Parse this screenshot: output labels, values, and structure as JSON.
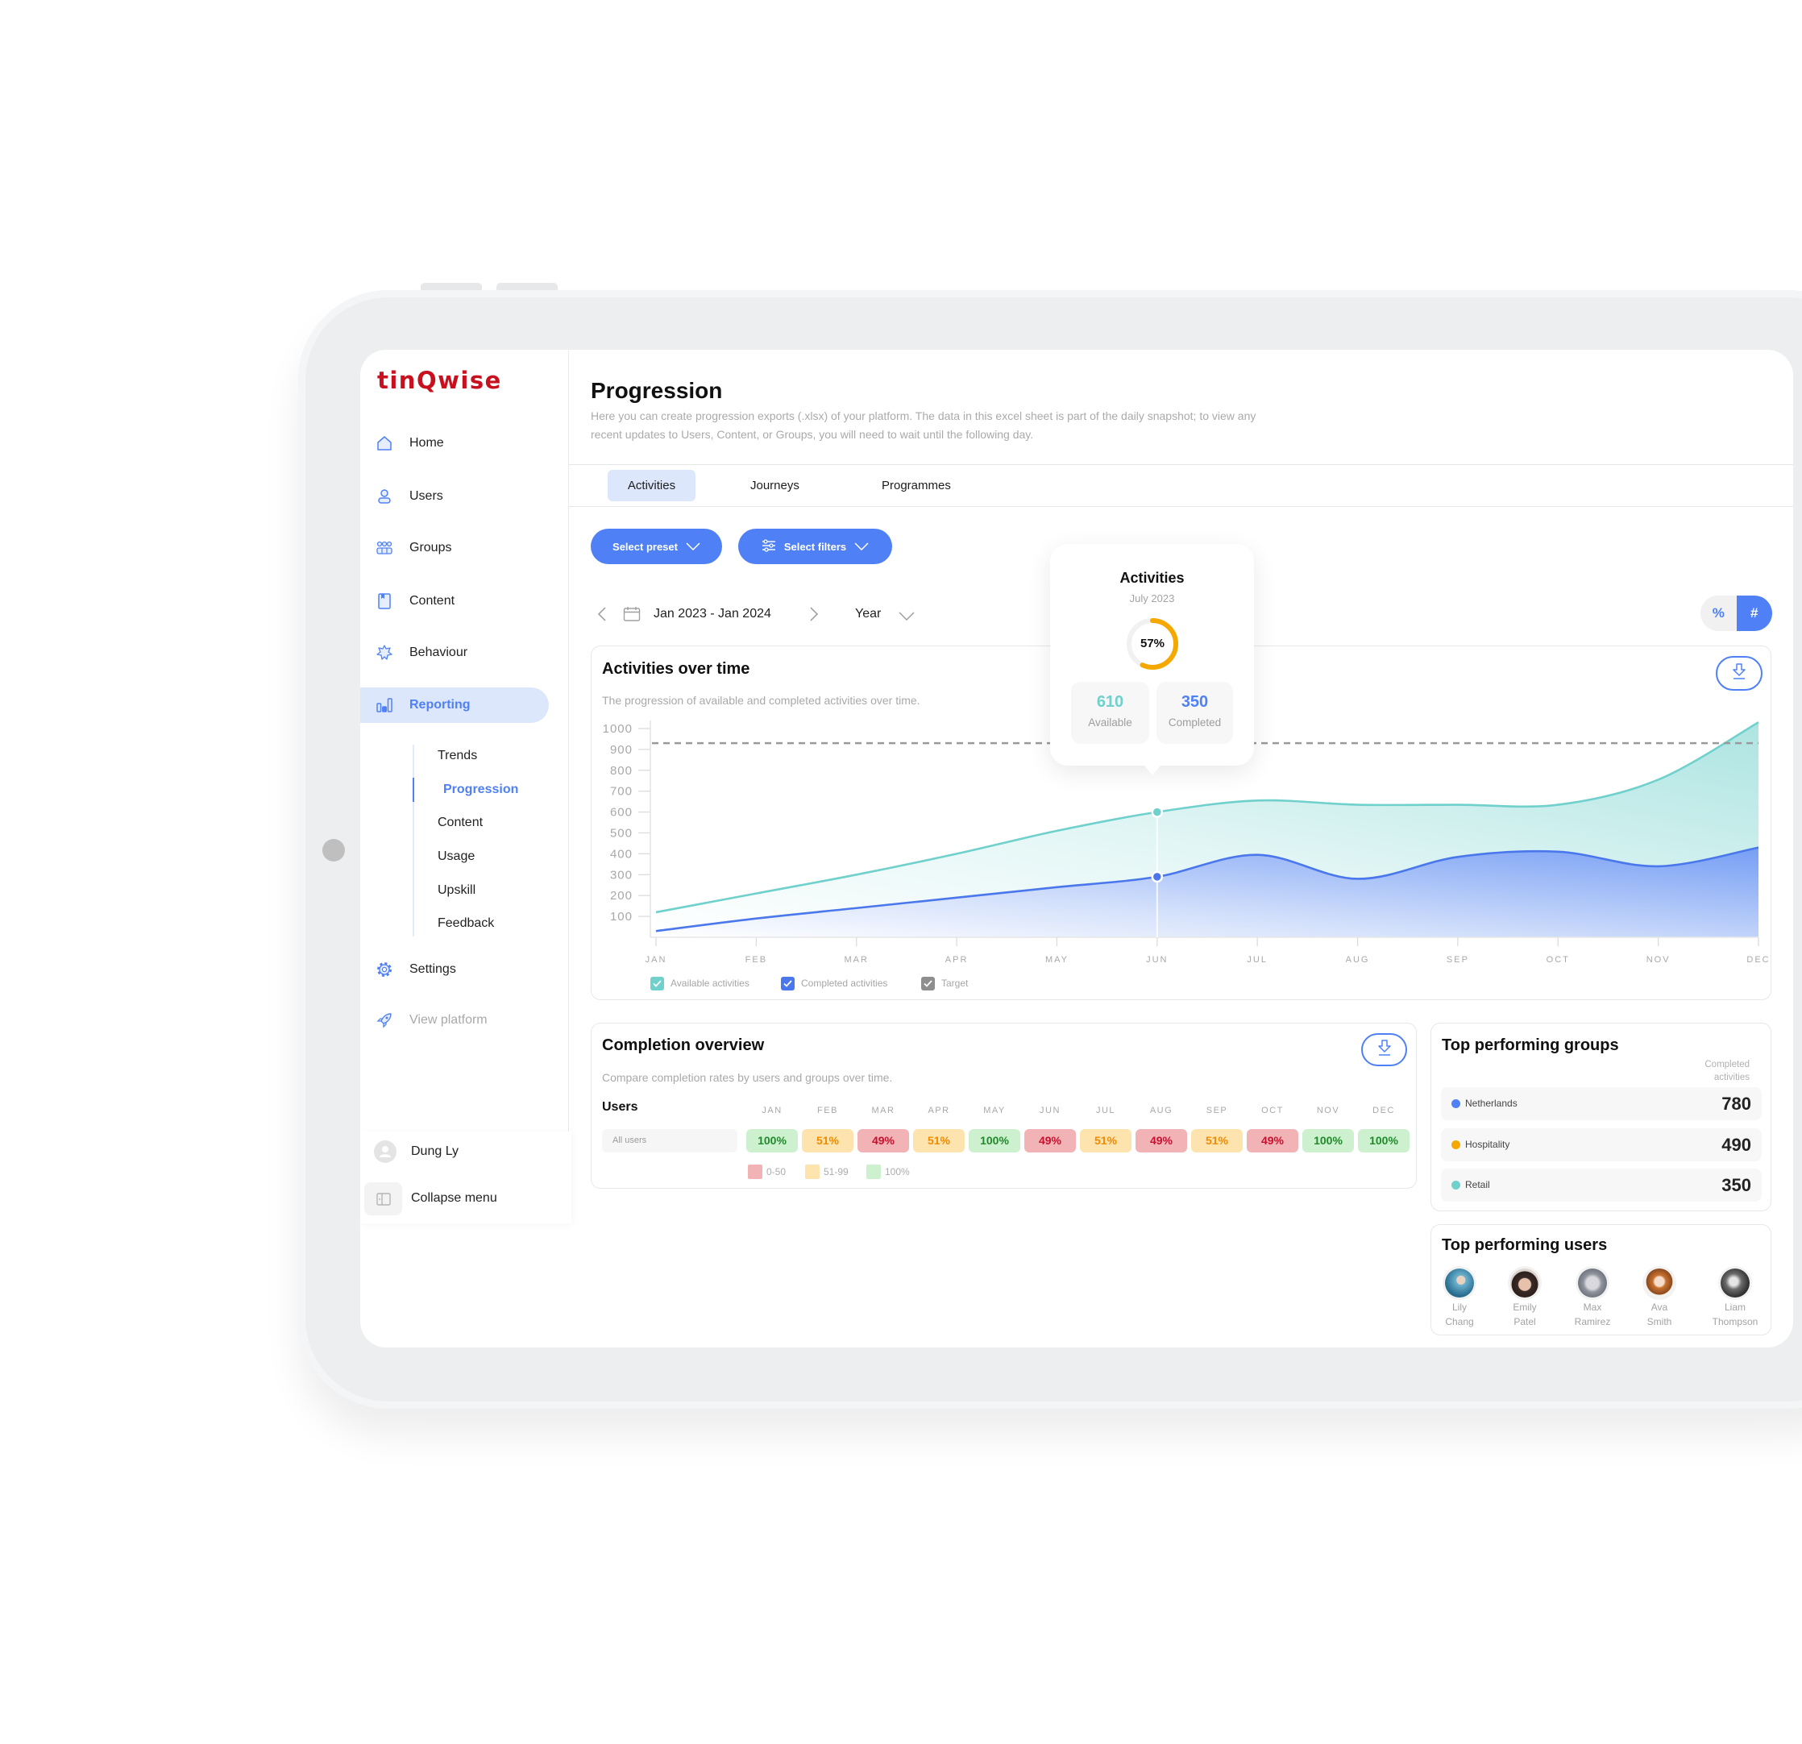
{
  "brand": {
    "logo_text": "tinQwise"
  },
  "colors": {
    "accent": "#4f80f5",
    "teal": "#6fd0cc",
    "brand_red": "#c8101e",
    "orange": "#f5a800",
    "active_bg": "#dde7fc"
  },
  "sidebar": {
    "items": [
      {
        "label": "Home",
        "icon": "home-icon"
      },
      {
        "label": "Users",
        "icon": "user-icon"
      },
      {
        "label": "Groups",
        "icon": "groups-icon"
      },
      {
        "label": "Content",
        "icon": "content-icon"
      },
      {
        "label": "Behaviour",
        "icon": "behaviour-icon"
      },
      {
        "label": "Reporting",
        "icon": "reporting-icon",
        "active": true
      }
    ],
    "reporting_subitems": [
      {
        "label": "Trends"
      },
      {
        "label": "Progression",
        "active": true
      },
      {
        "label": "Content"
      },
      {
        "label": "Usage"
      },
      {
        "label": "Upskill"
      },
      {
        "label": "Feedback"
      }
    ],
    "settings": {
      "label": "Settings",
      "icon": "gear-icon"
    },
    "view_platform": {
      "label": "View platform",
      "icon": "rocket-icon"
    },
    "user": {
      "name": "Dung Ly",
      "icon": "user-avatar-icon"
    },
    "collapse": {
      "label": "Collapse menu",
      "icon": "collapse-panel-icon"
    }
  },
  "page": {
    "title": "Progression",
    "description_lines": [
      "Here you can create progression exports (.xlsx) of your platform. The data in this excel sheet is part of the daily snapshot; to view any",
      "recent updates to Users, Content, or Groups, you will need to wait until the following day."
    ]
  },
  "tabs": {
    "items": [
      {
        "label": "Activities",
        "active": true
      },
      {
        "label": "Journeys"
      },
      {
        "label": "Programmes"
      }
    ]
  },
  "toolbar": {
    "preset_label": "Select preset",
    "filters_label": "Select filters",
    "date_range": "Jan 2023 - Jan 2024",
    "period": "Year",
    "display_toggle": {
      "options": [
        "%",
        "#"
      ],
      "selected": "#"
    }
  },
  "activities_card": {
    "title": "Activities over time",
    "subtitle": "The progression of available and completed activities over time."
  },
  "tooltip": {
    "title": "Activities",
    "date": "July 2023",
    "percent": 57,
    "percent_label": "57%",
    "available": {
      "value": "610",
      "label": "Available"
    },
    "completed": {
      "value": "350",
      "label": "Completed"
    }
  },
  "chart_data": {
    "type": "area",
    "title": "Activities over time",
    "subtitle": "The progression of available and completed activities over time.",
    "categories": [
      "JAN",
      "FEB",
      "MAR",
      "APR",
      "MAY",
      "JUN",
      "JUL",
      "AUG",
      "SEP",
      "OCT",
      "NOV",
      "DEC"
    ],
    "series": [
      {
        "name": "Available activities",
        "values": [
          120,
          210,
          300,
          400,
          510,
          600,
          655,
          635,
          635,
          635,
          755,
          1030
        ],
        "color": "#6fd0cc"
      },
      {
        "name": "Completed activities",
        "values": [
          30,
          90,
          140,
          190,
          240,
          290,
          395,
          280,
          385,
          410,
          340,
          430
        ],
        "color": "#4a78ec"
      }
    ],
    "target": {
      "name": "Target",
      "value": 930,
      "color": "#9a9a9a"
    },
    "y_ticks": [
      100,
      200,
      300,
      400,
      500,
      600,
      700,
      800,
      900,
      1000
    ],
    "ylim": [
      0,
      1050
    ],
    "xlabel": "",
    "ylabel": "",
    "grid": false,
    "legend_position": "bottom-left",
    "hover_index": 5
  },
  "completion": {
    "title": "Completion overview",
    "subtitle": "Compare completion rates by users and groups over time.",
    "section_label": "Users",
    "months": [
      "JAN",
      "FEB",
      "MAR",
      "APR",
      "MAY",
      "JUN",
      "JUL",
      "AUG",
      "SEP",
      "OCT",
      "NOV",
      "DEC"
    ],
    "rows": [
      {
        "label": "All users",
        "values": [
          "100%",
          "51%",
          "49%",
          "51%",
          "100%",
          "49%",
          "51%",
          "49%",
          "51%",
          "49%",
          "100%",
          "100%"
        ]
      }
    ],
    "legend": [
      {
        "label": "0-50",
        "color": "#f2b3b7"
      },
      {
        "label": "51-99",
        "color": "#fde4ae"
      },
      {
        "label": "100%",
        "color": "#cdf0cf"
      }
    ]
  },
  "top_groups": {
    "title": "Top performing groups",
    "column_label_lines": [
      "Completed",
      "activities"
    ],
    "items": [
      {
        "name": "Netherlands",
        "value": "780",
        "color": "#4f80f5"
      },
      {
        "name": "Hospitality",
        "value": "490",
        "color": "#f5a800"
      },
      {
        "name": "Retail",
        "value": "350",
        "color": "#6fd0cc"
      }
    ]
  },
  "top_users": {
    "title": "Top performing users",
    "users": [
      {
        "first": "Lily",
        "last": "Chang"
      },
      {
        "first": "Emily",
        "last": "Patel"
      },
      {
        "first": "Max",
        "last": "Ramirez"
      },
      {
        "first": "Ava",
        "last": "Smith"
      },
      {
        "first": "Liam",
        "last": "Thompson"
      }
    ]
  }
}
